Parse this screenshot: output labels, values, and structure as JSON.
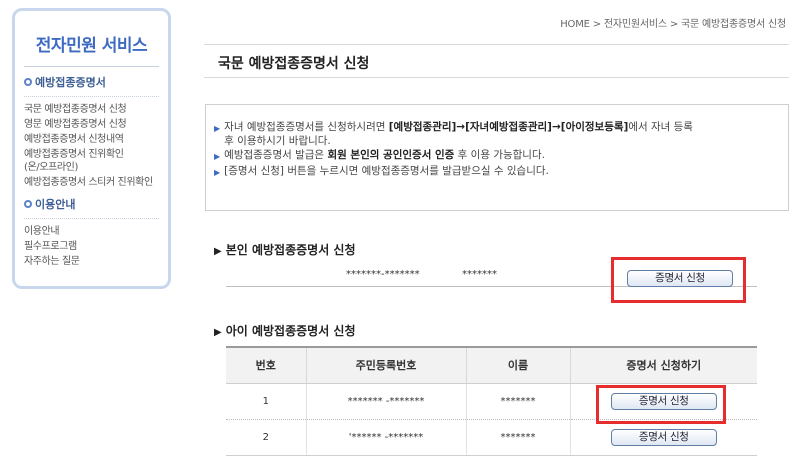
{
  "sidebar": {
    "title": "전자민원 서비스",
    "sections": [
      {
        "heading": "예방접종증명서",
        "items": [
          "국문 예방접종증명서 신청",
          "영문 예방접종증명서 신청",
          "예방접종증명서 신청내역",
          "예방접종증명서 진위확인\n(온/오프라인)",
          "예방접종증명서 스티커 진위확인"
        ]
      },
      {
        "heading": "이용안내",
        "items": [
          "이용안내",
          "필수프로그램",
          "자주하는 질문"
        ]
      }
    ]
  },
  "breadcrumb": "HOME > 전자민원서비스 > 국문 예방접종증명서 신청",
  "page_title": "국문 예방접종증명서 신청",
  "info": {
    "line1_pre": "자녀 예방접종증명서를 신청하시려면 ",
    "line1_bold": "[예방접종관리]→[자녀예방접종관리]→[아이정보등록]",
    "line1_post": "에서 자녀 등록",
    "line1_cont": "후 이용하시기 바랍니다.",
    "line2_pre": "예방접종증명서 발급은 ",
    "line2_bold": "회원 본인의 공인인증서 인증",
    "line2_post": " 후 이용 가능합니다.",
    "line3": "[증명서 신청] 버튼을 누르시면 예방접종증명서를 발급받으실 수 있습니다."
  },
  "self_section": {
    "title": "본인 예방접종증명서 신청",
    "rrn": "*******-*******",
    "name": "*******",
    "button": "증명서 신청"
  },
  "child_section": {
    "title": "아이 예방접종증명서 신청",
    "headers": [
      "번호",
      "주민등록번호",
      "이름",
      "증명서 신청하기"
    ],
    "rows": [
      {
        "no": "1",
        "rrn": "******* -*******",
        "name": "*******",
        "button": "증명서 신청"
      },
      {
        "no": "2",
        "rrn": "'****** -*******",
        "name": "*******",
        "button": "증명서 신청"
      }
    ]
  },
  "colors": {
    "accent": "#3e6bc2",
    "highlight": "#e52d2d",
    "sidebar_border": "#c9d7ee"
  }
}
